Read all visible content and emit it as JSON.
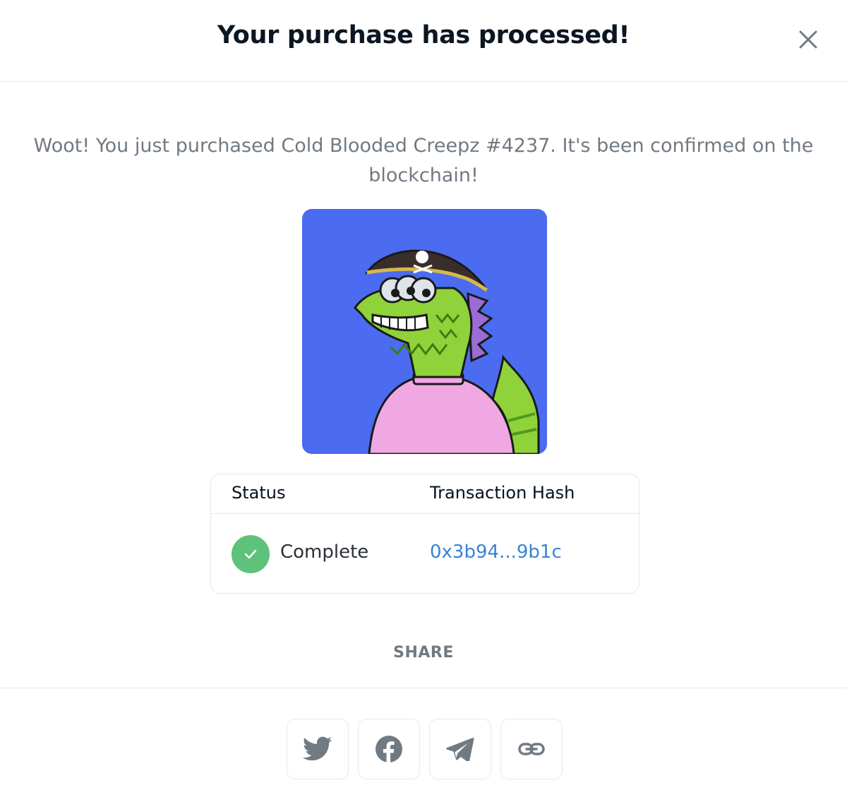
{
  "modal": {
    "title": "Your purchase has processed!",
    "close_icon": "close-icon"
  },
  "message": "Woot! You just purchased Cold Blooded Creepz #4237. It's been confirmed on the blockchain!",
  "nft": {
    "background_color": "#4b6cf0"
  },
  "status_table": {
    "headers": {
      "status": "Status",
      "hash": "Transaction Hash"
    },
    "status_value": "Complete",
    "status_icon": "check-icon",
    "status_color": "#5ec27a",
    "hash_value": "0x3b94...9b1c",
    "hash_color": "#3b82d6"
  },
  "share": {
    "label": "SHARE",
    "buttons": [
      {
        "name": "twitter",
        "icon": "twitter-icon"
      },
      {
        "name": "facebook",
        "icon": "facebook-icon"
      },
      {
        "name": "telegram",
        "icon": "telegram-icon"
      },
      {
        "name": "copy-link",
        "icon": "link-icon"
      }
    ]
  }
}
